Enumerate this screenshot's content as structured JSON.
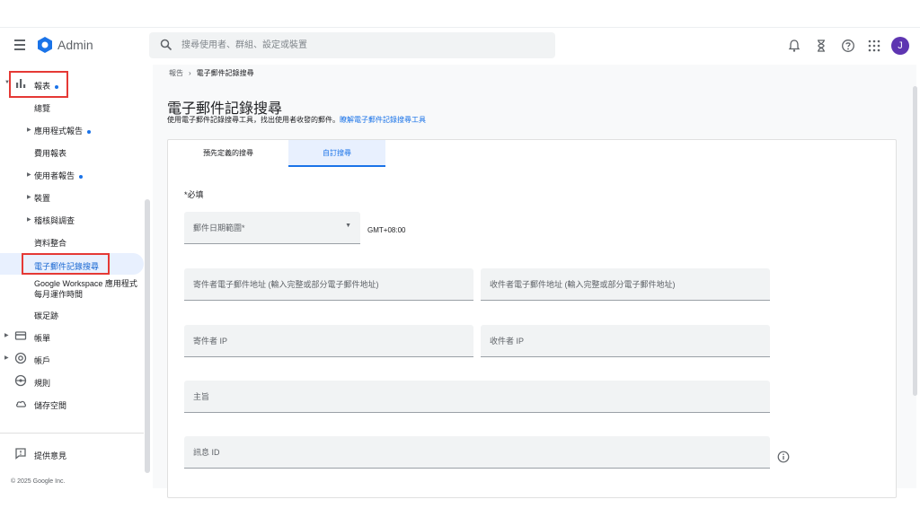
{
  "header": {
    "app_name": "Admin",
    "search_placeholder": "搜尋使用者、群組、設定或裝置",
    "avatar_initial": "J"
  },
  "sidebar": {
    "reports": "報表",
    "overview": "總覽",
    "app_reports": "應用程式報告",
    "cost_reports": "費用報表",
    "user_reports": "使用者報告",
    "devices": "裝置",
    "audit": "稽核與調查",
    "data_integration": "資料整合",
    "email_log_search": "電子郵件記錄搜尋",
    "workspace_uptime_line1": "Google Workspace 應用程式",
    "workspace_uptime_line2": "每月運作時間",
    "footprint": "碳足跡",
    "billing": "帳單",
    "account": "帳戶",
    "rules": "規則",
    "storage": "儲存空間",
    "feedback": "提供意見",
    "copyright": "© 2025 Google Inc."
  },
  "main": {
    "breadcrumb_parent": "報告",
    "breadcrumb_sep": "›",
    "breadcrumb_current": "電子郵件記錄搜尋",
    "title": "電子郵件記錄搜尋",
    "subtitle": "使用電子郵件記錄搜尋工具，找出使用者收發的郵件。",
    "subtitle_link": "瞭解電子郵件記錄搜尋工具",
    "tabs": [
      {
        "label": "預先定義的搜尋"
      },
      {
        "label": "自訂搜尋"
      }
    ],
    "required_note": "*必填",
    "date_range_label": "郵件日期範圍*",
    "timezone": "GMT+08:00",
    "sender_label": "寄件者電子郵件地址 (輸入完整或部分電子郵件地址)",
    "recipient_label": "收件者電子郵件地址 (輸入完整或部分電子郵件地址)",
    "sender_ip_label": "寄件者 IP",
    "recipient_ip_label": "收件者 IP",
    "subject_label": "主旨",
    "message_id_label": "訊息 ID"
  },
  "colors": {
    "accent": "#1a73e8",
    "highlight_box": "#e53935",
    "avatar": "#5e35b1"
  },
  "icons": [
    "menu-icon",
    "admin-logo-icon",
    "search-icon",
    "bell-icon",
    "hourglass-icon",
    "help-icon",
    "apps-grid-icon",
    "bar-chart-icon",
    "credit-card-icon",
    "at-icon",
    "steering-wheel-icon",
    "cloud-icon",
    "feedback-icon",
    "info-icon",
    "dropdown-arrow-icon"
  ]
}
